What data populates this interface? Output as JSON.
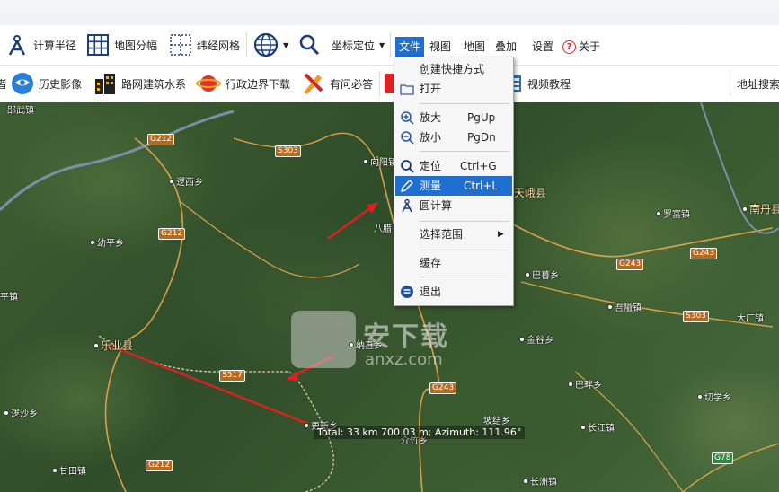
{
  "toolbar1": {
    "calc_radius": "计算半径",
    "map_sheet": "地图分幅",
    "latlon_grid": "纬经网格",
    "coord_locate": "坐标定位"
  },
  "menubar": {
    "items": [
      "文件",
      "视图",
      "地图",
      "叠加",
      "设置",
      "关于"
    ]
  },
  "toolbar2": {
    "partial_left": "者",
    "history_image": "历史影像",
    "road_building": "路网建筑水系",
    "admin_download": "行政边界下载",
    "qa": "有问必答",
    "video_tutorial": "视频教程",
    "address_search": "地址搜索"
  },
  "file_menu": {
    "create_shortcut": "创建快捷方式",
    "open": "打开",
    "zoom_in": "放大",
    "zoom_in_key": "PgUp",
    "zoom_out": "放小",
    "zoom_out_key": "PgDn",
    "locate": "定位",
    "locate_key": "Ctrl+G",
    "measure": "测量",
    "measure_key": "Ctrl+L",
    "circle_calc": "圆计算",
    "select_range": "选择范围",
    "cache": "缓存",
    "exit": "退出"
  },
  "map": {
    "places": {
      "luwu": "郘武镇",
      "xiyan": "逻西乡",
      "youping": "幼平乡",
      "leye": "乐业县",
      "ping": "平镇",
      "lusha": "逻沙乡",
      "gantian": "甘田镇",
      "xiangyang": "向阳镇",
      "tiane": "天峨县",
      "bamo": "巴暮乡",
      "naping": "纳直乡",
      "gengxin": "更新乡",
      "jiezhu": "介竹乡",
      "baling": "八腊",
      "bayue": "巴暮乡",
      "luofu": "罗富镇",
      "nandan": "南丹县",
      "wuban": "吾隘镇",
      "dachang": "大厂镇",
      "jinhe": "金谷乡",
      "bahe": "巴畔乡",
      "qiexue": "切学乡",
      "pojiao": "坡结乡",
      "changjiang": "长江镇",
      "changzhou": "长洲镇"
    },
    "roads": [
      "G212",
      "S303",
      "G212",
      "S517",
      "G243",
      "G243",
      "S303",
      "G243",
      "G78",
      "G212"
    ],
    "status_text": "Total: 33 km 700.03 m; Azimuth: 111.96°",
    "watermark_text": "安下载",
    "watermark_sub": "anxz.com"
  }
}
